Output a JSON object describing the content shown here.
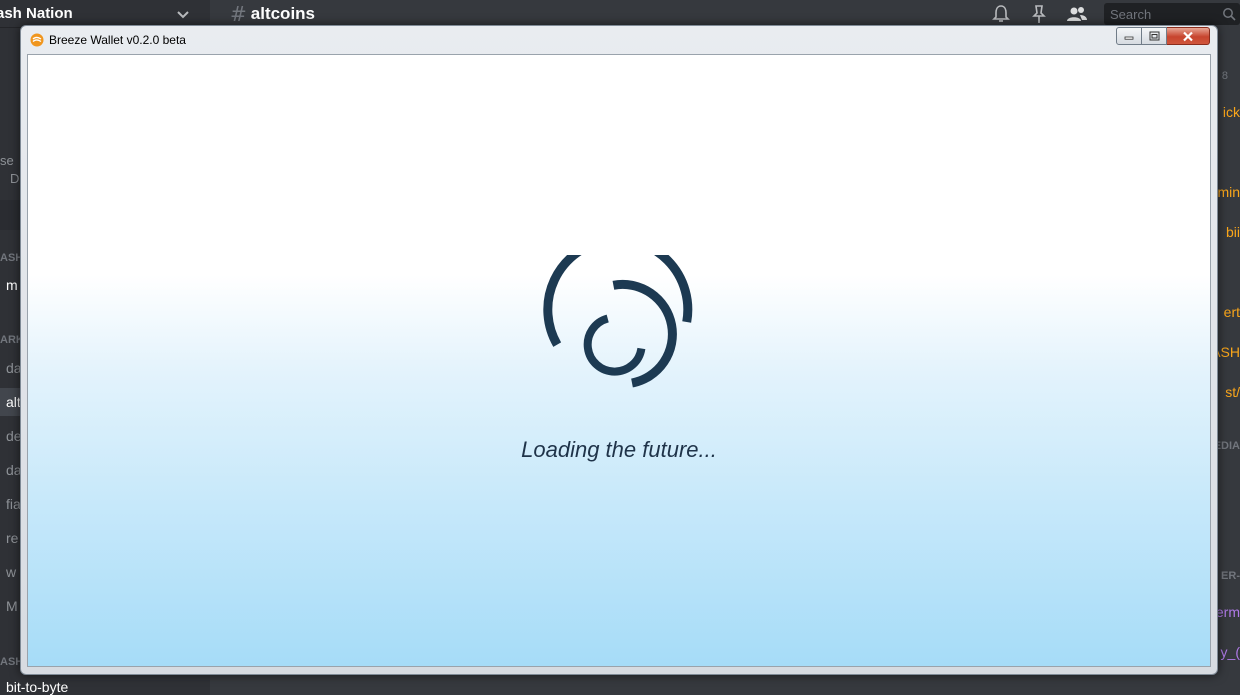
{
  "background_app": {
    "server_name": "ash Nation",
    "channel_hash": "#",
    "channel_name": "altcoins",
    "search_placeholder": "Search",
    "sidebar_fragments": [
      {
        "text": "se",
        "top": 0
      },
      {
        "text": "D",
        "top": 0
      },
      {
        "text": "ASH",
        "top": 0
      },
      {
        "text": "m",
        "top": 0
      },
      {
        "text": "ARK",
        "top": 0
      },
      {
        "text": "da",
        "top": 0
      },
      {
        "text": "alt",
        "top": 0
      },
      {
        "text": "de",
        "top": 0
      },
      {
        "text": "da",
        "top": 0
      },
      {
        "text": "fia",
        "top": 0
      },
      {
        "text": "re",
        "top": 0
      },
      {
        "text": "w",
        "top": 0
      },
      {
        "text": "M",
        "top": 0
      },
      {
        "text": "ASH",
        "top": 0
      },
      {
        "text": "bit-to-byte",
        "top": 0
      }
    ],
    "right_fragments": [
      "8",
      "ick",
      "min",
      "bii",
      "ert",
      "ASH",
      "st/",
      "EDIA",
      "ER-",
      "erm",
      "y_("
    ],
    "colors": {
      "sidebar": "#2f3136",
      "chat": "#36393e",
      "highlight_yellow": "#faa61a",
      "highlight_purple": "#b07ae8"
    }
  },
  "window": {
    "title": "Breeze Wallet v0.2.0 beta",
    "controls": {
      "minimize": "minimize",
      "maximize": "maximize",
      "close": "close"
    },
    "loading_text": "Loading the future...",
    "spinner_color": "#1d3a52"
  }
}
